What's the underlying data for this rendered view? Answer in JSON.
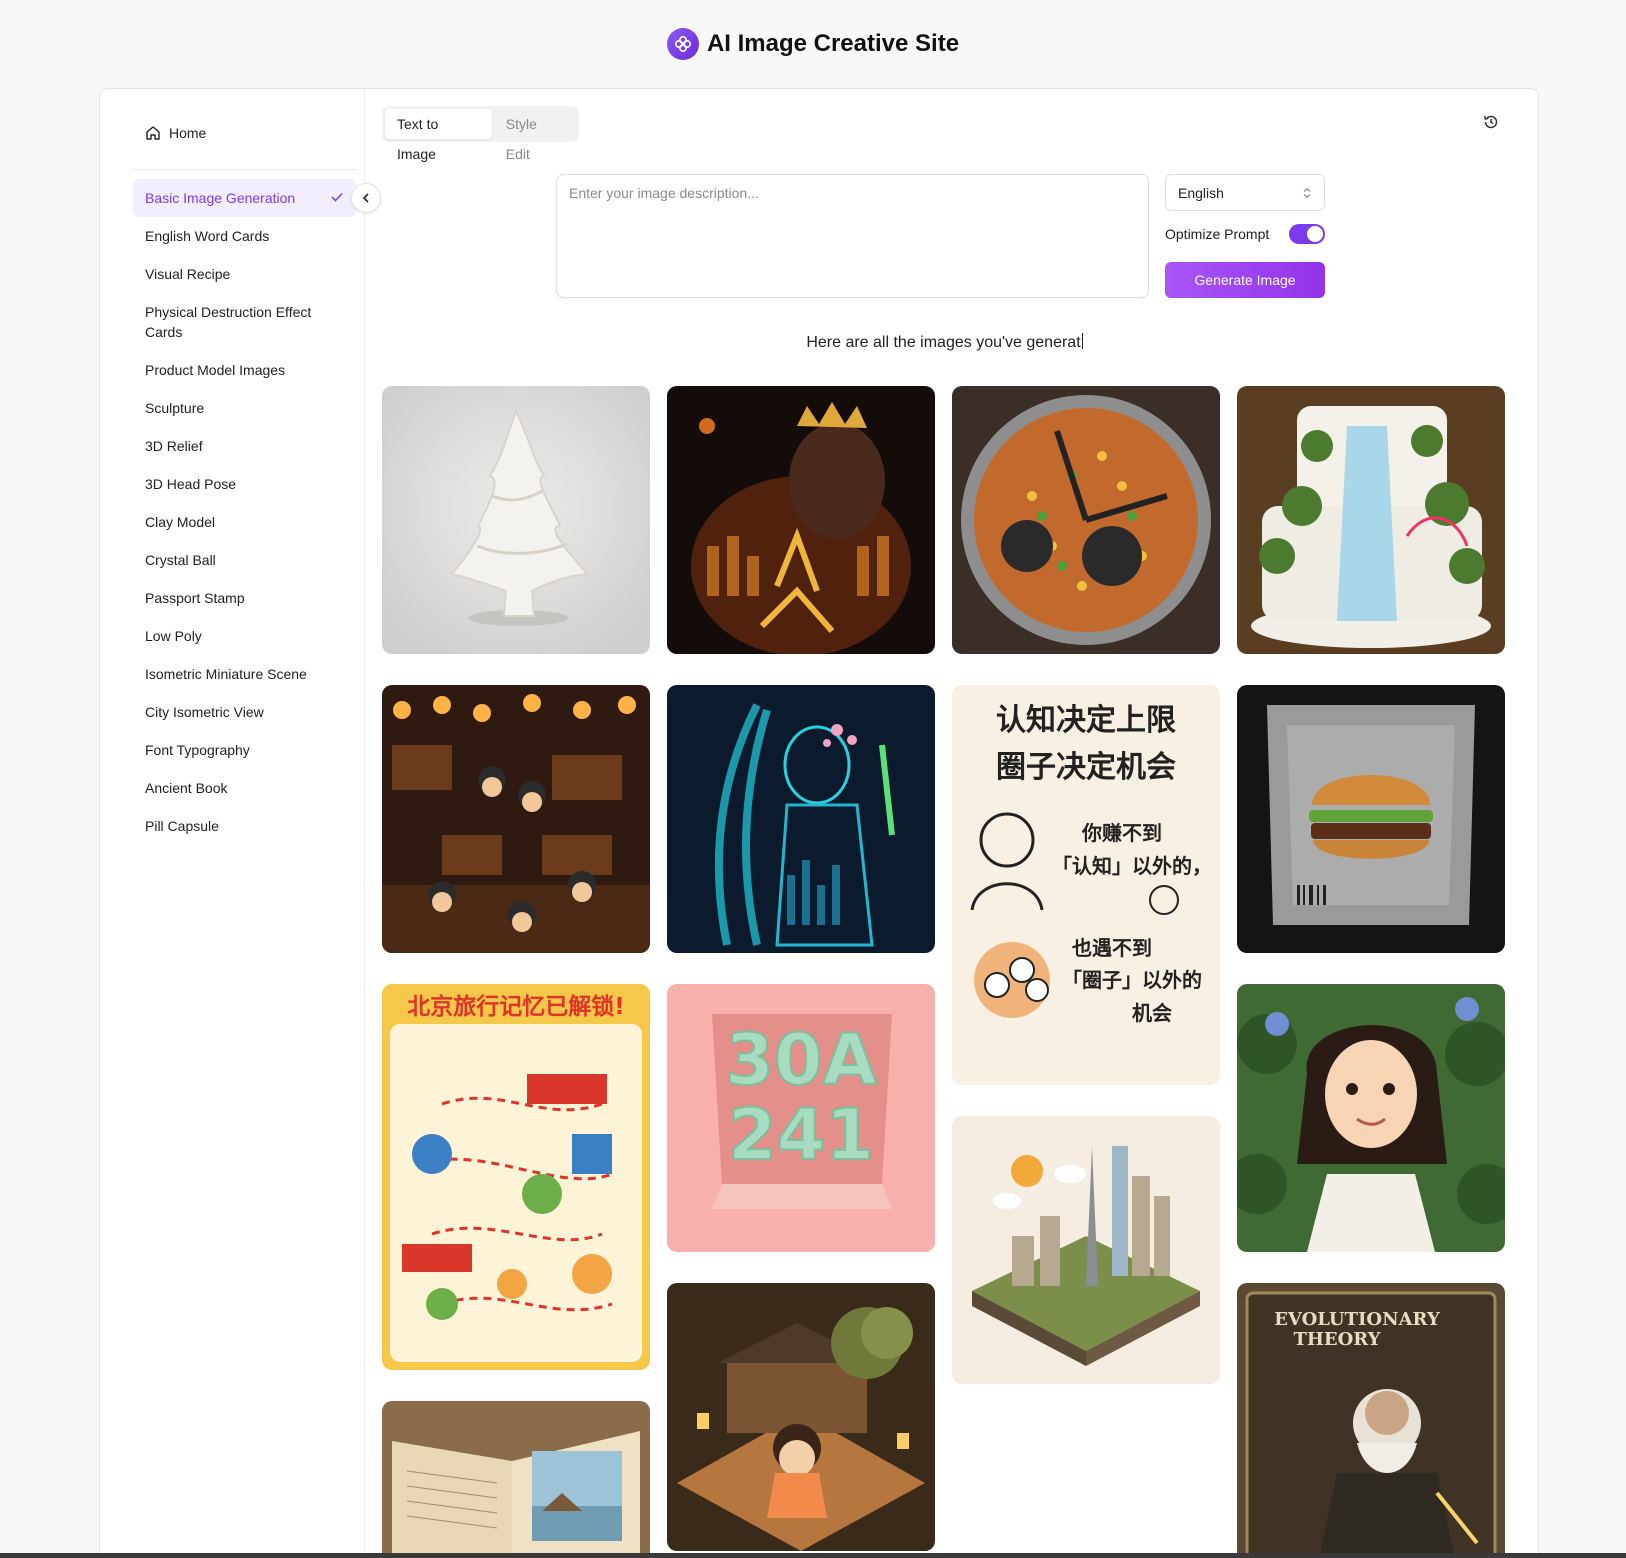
{
  "site": {
    "title": "AI Image Creative Site",
    "logo_icon": "flower-logo-icon",
    "accent": "#7c3aed"
  },
  "sidebar": {
    "home_label": "Home",
    "items": [
      {
        "label": "Basic Image Generation",
        "active": true
      },
      {
        "label": "English Word Cards"
      },
      {
        "label": "Visual Recipe"
      },
      {
        "label": "Physical Destruction Effect Cards"
      },
      {
        "label": "Product Model Images"
      },
      {
        "label": "Sculpture"
      },
      {
        "label": "3D Relief"
      },
      {
        "label": "3D Head Pose"
      },
      {
        "label": "Clay Model"
      },
      {
        "label": "Crystal Ball"
      },
      {
        "label": "Passport Stamp"
      },
      {
        "label": "Low Poly"
      },
      {
        "label": "Isometric Miniature Scene"
      },
      {
        "label": "City Isometric View"
      },
      {
        "label": "Font Typography"
      },
      {
        "label": "Ancient Book"
      },
      {
        "label": "Pill Capsule"
      }
    ]
  },
  "tabs": [
    {
      "label": "Text to Image",
      "active": true
    },
    {
      "label": "Style Edit"
    }
  ],
  "prompt": {
    "placeholder": "Enter your image description..."
  },
  "options": {
    "language": "English",
    "optimize_label": "Optimize Prompt",
    "optimize_on": true,
    "generate_label": "Generate Image"
  },
  "gallery": {
    "heading": "Here are all the images you've generat",
    "images": [
      {
        "subject": "white-tree-sculpture"
      },
      {
        "subject": "basketball-king-poster"
      },
      {
        "subject": "watch-fried-rice"
      },
      {
        "subject": "waterfall-cake"
      },
      {
        "subject": "night-market-figures"
      },
      {
        "subject": "neon-singer"
      },
      {
        "subject": "chinese-text-poster",
        "lines": [
          "认知决定上限",
          "圈子决定机会",
          "你赚不到",
          "「认知」以外的，",
          "也遇不到",
          "「圈子」以外的",
          "机会"
        ]
      },
      {
        "subject": "burger-pouch"
      },
      {
        "subject": "beijing-travel-map",
        "title": "北京旅行记忆已解锁!"
      },
      {
        "subject": "3d-letters-box",
        "text": [
          "30A",
          "241"
        ]
      },
      {
        "subject": "isometric-city"
      },
      {
        "subject": "anime-girl"
      },
      {
        "subject": "ancient-book"
      },
      {
        "subject": "garden-girl"
      },
      {
        "subject": "evolution-card",
        "title": [
          "EVOLUTIONARY",
          "THEORY"
        ]
      }
    ]
  }
}
